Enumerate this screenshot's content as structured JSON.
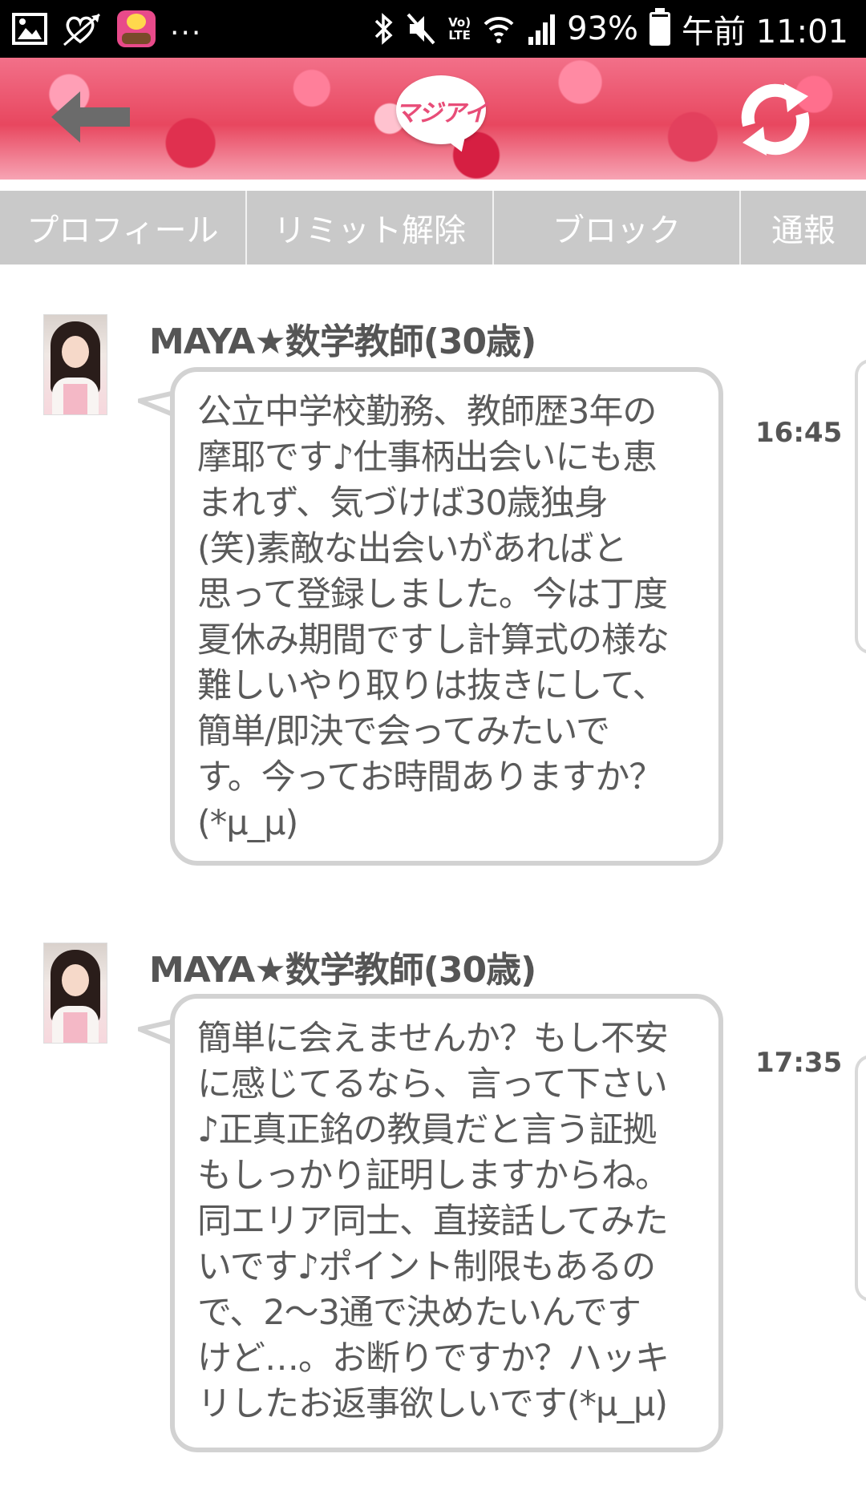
{
  "status_bar": {
    "notification_more": "...",
    "volte_top": "Vo)",
    "volte_bottom": "LTE",
    "battery_percent": "93%",
    "battery_level": 0.93,
    "clock": "午前 11:01"
  },
  "header": {
    "logo_text": "マジアイ"
  },
  "tabs": [
    {
      "label": "プロフィール"
    },
    {
      "label": "リミット解除"
    },
    {
      "label": "ブロック"
    },
    {
      "label": "通報"
    }
  ],
  "messages": [
    {
      "sender": "MAYA★数学教師(30歳)",
      "text": "公立中学校勤務、教師歴3年の\n摩耶です♪仕事柄出会いにも恵\nまれず、気づけば30歳独身\n(笑)素敵な出会いがあればと\n思って登録しました。今は丁度\n夏休み期間ですし計算式の様な\n難しいやり取りは抜きにして、\n簡単/即決で会ってみたいで\nす。今ってお時間ありますか？\n(*μ_μ)",
      "time": "16:45"
    },
    {
      "sender": "MAYA★数学教師(30歳)",
      "text": "簡単に会えませんか？もし不安\nに感じてるなら、言って下さい\n♪正真正銘の教員だと言う証拠\nもしっかり証明しますからね。\n同エリア同士、直接話してみた\nいです♪ポイント制限もあるの\nで、2〜3通で決めたいんです\nけど…。お断りですか？ハッキ\nリしたお返事欲しいです(*μ_μ)",
      "time": "17:35"
    }
  ],
  "colors": {
    "status_bar_bg": "#000000",
    "tab_bg": "#c9c9c9",
    "bubble_border": "#d2d2d2",
    "text": "#5a5a5a",
    "header_pink": "#e8475f"
  }
}
